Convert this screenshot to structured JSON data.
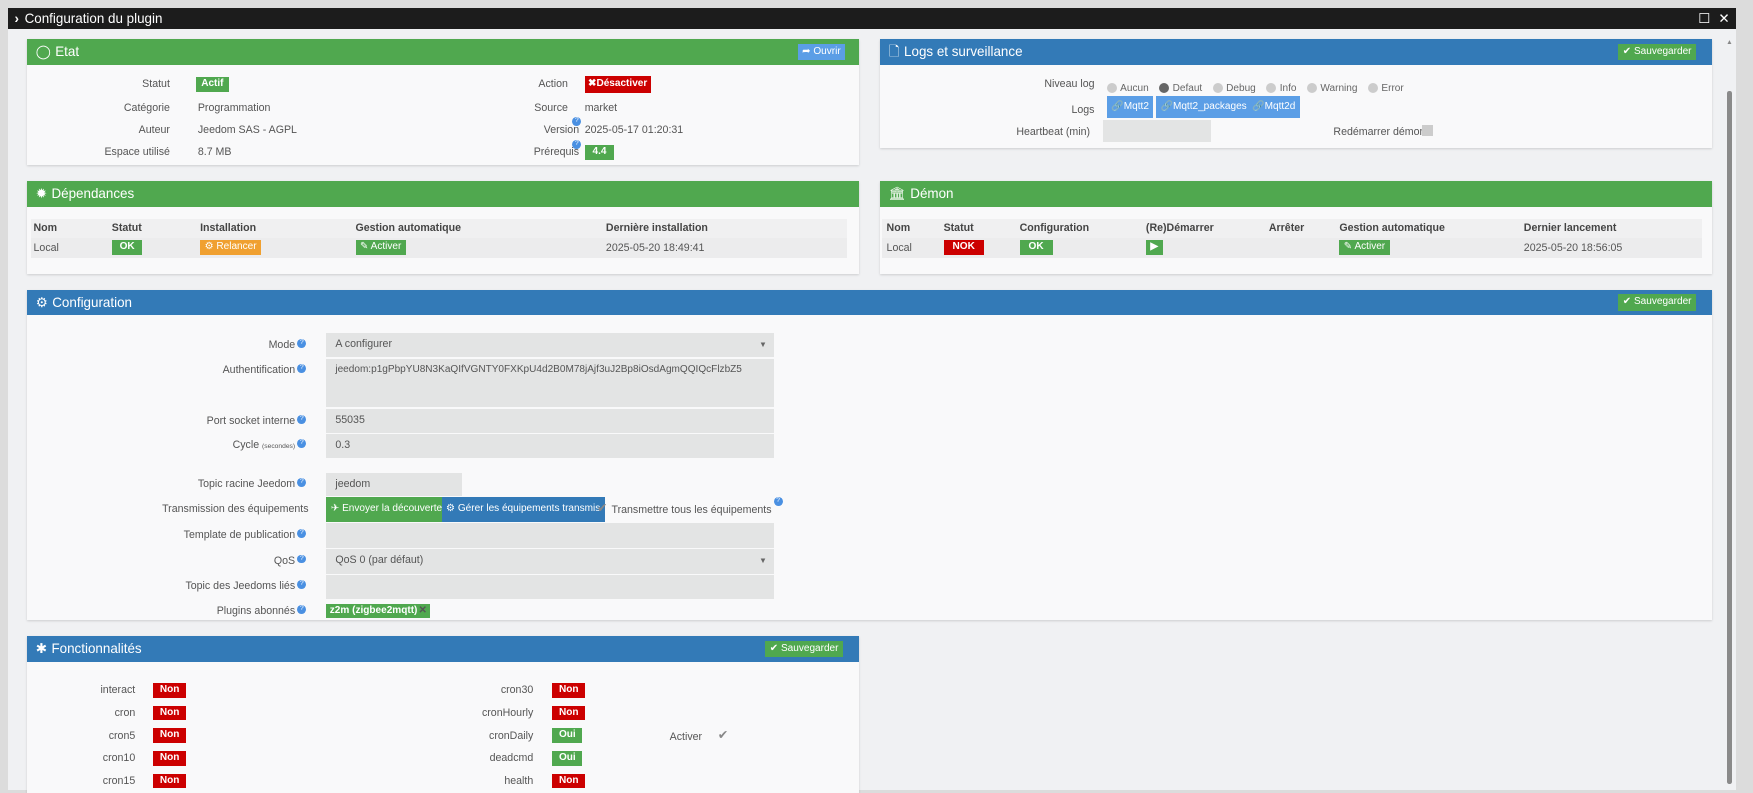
{
  "window": {
    "title": "Configuration du plugin",
    "maximize_icon": "square-icon",
    "close_icon": "x-icon"
  },
  "etat": {
    "title": "Etat",
    "open_button": "Ouvrir",
    "left": [
      {
        "label": "Statut",
        "value": "Actif"
      },
      {
        "label": "Catégorie",
        "value": "Programmation"
      },
      {
        "label": "Auteur",
        "value": "Jeedom SAS - AGPL"
      },
      {
        "label": "Espace utilisé",
        "value": "8.7 MB"
      }
    ],
    "right": [
      {
        "label": "Action",
        "value": "Désactiver"
      },
      {
        "label": "Source",
        "value": "market"
      },
      {
        "label": "Version",
        "value": "2025-05-17 01:20:31"
      },
      {
        "label": "Prérequis",
        "value": "4.4"
      }
    ]
  },
  "logs": {
    "title": "Logs et surveillance",
    "save_button": "Sauvegarder",
    "level_label": "Niveau log",
    "levels": [
      "Aucun",
      "Defaut",
      "Debug",
      "Info",
      "Warning",
      "Error"
    ],
    "selected_level": "Defaut",
    "logs_label": "Logs",
    "log_buttons": [
      "Mqtt2",
      "Mqtt2_packages",
      "Mqtt2d"
    ],
    "heartbeat_label": "Heartbeat (min)",
    "heartbeat_value": "",
    "restart_label": "Redémarrer démon",
    "restart_checked": false
  },
  "deps": {
    "title": "Dépendances",
    "headers": [
      "Nom",
      "Statut",
      "Installation",
      "Gestion automatique",
      "Dernière installation"
    ],
    "row": {
      "name": "Local",
      "status": "OK",
      "install": "Relancer",
      "auto": "Activer",
      "last": "2025-05-20 18:49:41"
    }
  },
  "daemon": {
    "title": "Démon",
    "headers": [
      "Nom",
      "Statut",
      "Configuration",
      "(Re)Démarrer",
      "Arrêter",
      "Gestion automatique",
      "Dernier lancement"
    ],
    "row": {
      "name": "Local",
      "status": "NOK",
      "config": "OK",
      "auto": "Activer",
      "last": "2025-05-20 18:56:05"
    }
  },
  "config": {
    "title": "Configuration",
    "save_button": "Sauvegarder",
    "mode_label": "Mode",
    "mode_value": "A configurer",
    "auth_label": "Authentification",
    "auth_value": "jeedom:p1gPbpYU8N3KaQIfVGNTY0FXKpU4d2B0M78jAjf3uJ2Bp8iOsdAgmQQIQcFlzbZ5",
    "port_label": "Port socket interne",
    "port_value": "55035",
    "cycle_label": "Cycle",
    "cycle_unit": "(secondes)",
    "cycle_value": "0.3",
    "topic_label": "Topic racine Jeedom",
    "topic_value": "jeedom",
    "transmission_label": "Transmission des équipements",
    "send_discovery": "Envoyer la découverte",
    "manage_transmitted": "Gérer les équipements transmis",
    "transmit_all_label": "Transmettre tous les équipements",
    "transmit_all_checked": true,
    "template_label": "Template de publication",
    "template_value": "",
    "qos_label": "QoS",
    "qos_value": "QoS 0 (par défaut)",
    "linked_label": "Topic des Jeedoms liés",
    "linked_value": "",
    "plugins_label": "Plugins abonnés",
    "plugins": [
      "z2m (zigbee2mqtt)"
    ]
  },
  "features": {
    "title": "Fonctionnalités",
    "save_button": "Sauvegarder",
    "col1": [
      {
        "name": "interact",
        "value": "Non"
      },
      {
        "name": "cron",
        "value": "Non"
      },
      {
        "name": "cron5",
        "value": "Non"
      },
      {
        "name": "cron10",
        "value": "Non"
      },
      {
        "name": "cron15",
        "value": "Non"
      }
    ],
    "col2": [
      {
        "name": "cron30",
        "value": "Non"
      },
      {
        "name": "cronHourly",
        "value": "Non"
      },
      {
        "name": "cronDaily",
        "value": "Oui"
      },
      {
        "name": "deadcmd",
        "value": "Oui"
      },
      {
        "name": "health",
        "value": "Non"
      }
    ],
    "activate_label": "Activer",
    "activate_checked": true
  },
  "colors": {
    "green": "#50a84f",
    "blue": "#337ab7",
    "red": "#cc0000",
    "orange": "#f0a030",
    "light_blue": "#5b9ee6"
  }
}
